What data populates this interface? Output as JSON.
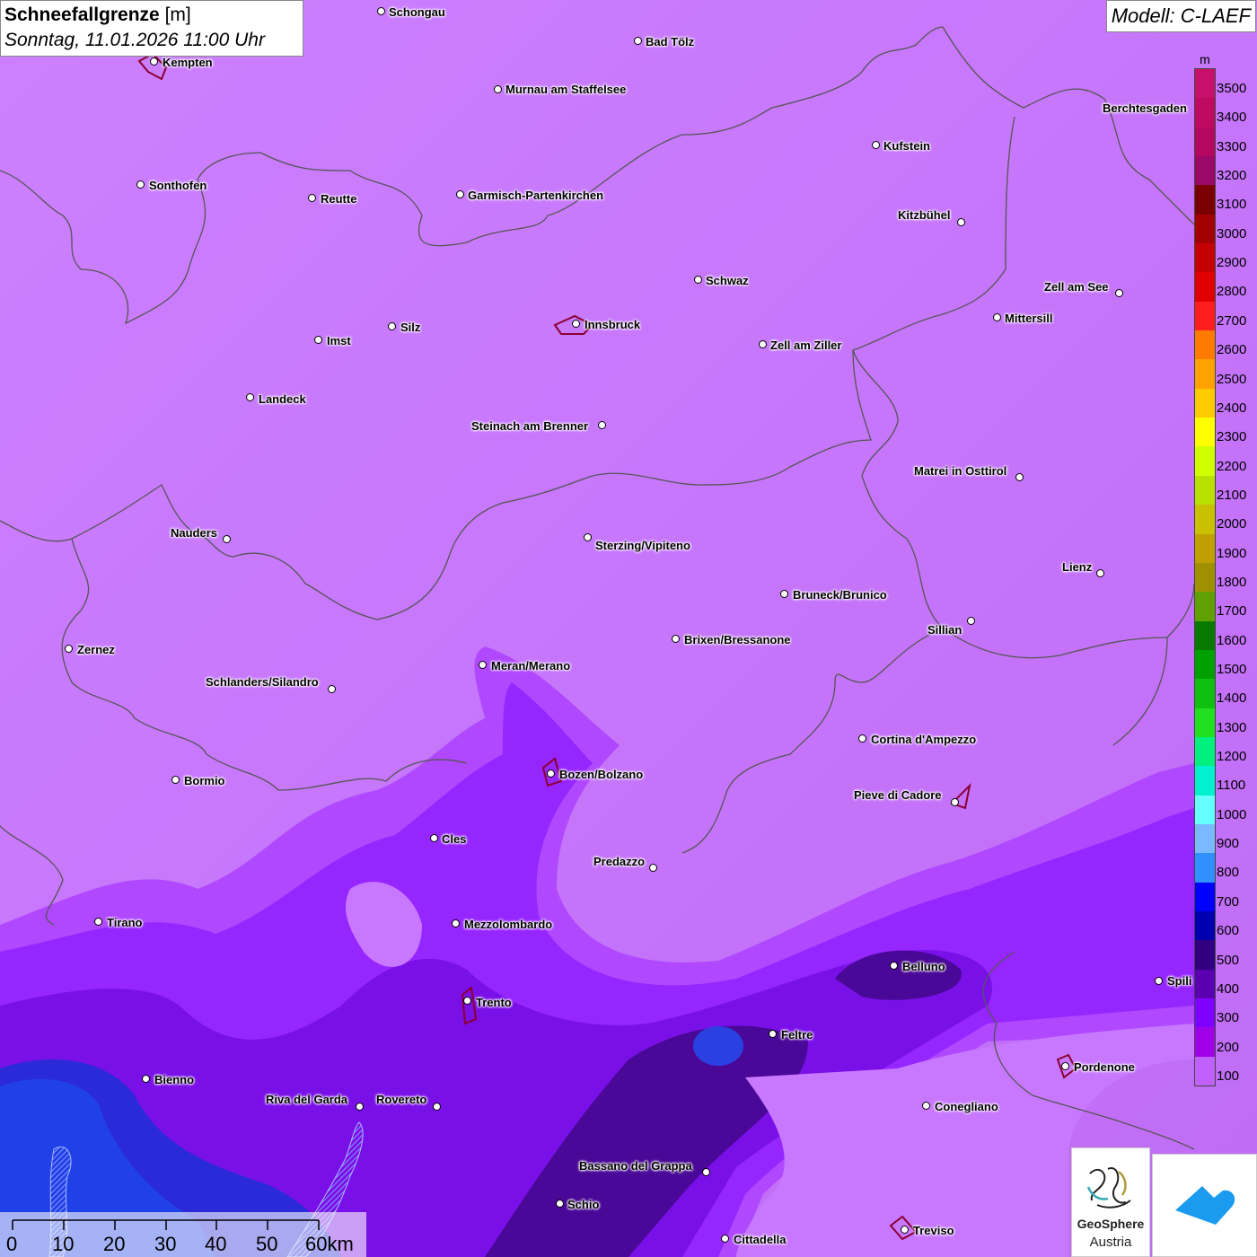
{
  "title": {
    "main": "Schneefallgrenze",
    "unit": "[m]",
    "datetime": "Sonntag, 11.01.2026 11:00 Uhr"
  },
  "model": "Modell: C-LAEF",
  "legend": {
    "unit": "m",
    "levels": [
      {
        "label": "3500",
        "color": "#c8106a"
      },
      {
        "label": "3400",
        "color": "#bf0a62"
      },
      {
        "label": "3300",
        "color": "#b40860"
      },
      {
        "label": "3200",
        "color": "#9a0868"
      },
      {
        "label": "3100",
        "color": "#7a0000"
      },
      {
        "label": "3000",
        "color": "#a30000"
      },
      {
        "label": "2900",
        "color": "#c40000"
      },
      {
        "label": "2800",
        "color": "#e00000"
      },
      {
        "label": "2700",
        "color": "#ff1e1e"
      },
      {
        "label": "2600",
        "color": "#ff7a00"
      },
      {
        "label": "2500",
        "color": "#ffa200"
      },
      {
        "label": "2400",
        "color": "#ffcb00"
      },
      {
        "label": "2300",
        "color": "#ffff00"
      },
      {
        "label": "2200",
        "color": "#d0ff00"
      },
      {
        "label": "2100",
        "color": "#b8e000"
      },
      {
        "label": "2000",
        "color": "#c8c000"
      },
      {
        "label": "1900",
        "color": "#c0a000"
      },
      {
        "label": "1800",
        "color": "#a09000"
      },
      {
        "label": "1700",
        "color": "#60a000"
      },
      {
        "label": "1600",
        "color": "#087a00"
      },
      {
        "label": "1500",
        "color": "#00a000"
      },
      {
        "label": "1400",
        "color": "#10c010"
      },
      {
        "label": "1300",
        "color": "#20e020"
      },
      {
        "label": "1200",
        "color": "#00f080"
      },
      {
        "label": "1100",
        "color": "#00f0d0"
      },
      {
        "label": "1000",
        "color": "#6ff"
      },
      {
        "label": "900",
        "color": "#7ab8ff"
      },
      {
        "label": "800",
        "color": "#3090ff"
      },
      {
        "label": "700",
        "color": "#0000ff"
      },
      {
        "label": "600",
        "color": "#0000b0"
      },
      {
        "label": "500",
        "color": "#300080"
      },
      {
        "label": "400",
        "color": "#5a00b0"
      },
      {
        "label": "300",
        "color": "#8000ff"
      },
      {
        "label": "200",
        "color": "#a000e8"
      },
      {
        "label": "100",
        "color": "#c060ff"
      }
    ]
  },
  "cities": [
    {
      "name": "Schongau"
    },
    {
      "name": "Bad Tölz"
    },
    {
      "name": "Kempten"
    },
    {
      "name": "Murnau am Staffelsee"
    },
    {
      "name": "Berchtesgaden"
    },
    {
      "name": "Kufstein"
    },
    {
      "name": "Sonthofen"
    },
    {
      "name": "Reutte"
    },
    {
      "name": "Garmisch-Partenkirchen"
    },
    {
      "name": "Kitzbühel"
    },
    {
      "name": "Schwaz"
    },
    {
      "name": "Zell am See"
    },
    {
      "name": "Mittersill"
    },
    {
      "name": "Innsbruck"
    },
    {
      "name": "Silz"
    },
    {
      "name": "Imst"
    },
    {
      "name": "Zell am Ziller"
    },
    {
      "name": "Landeck"
    },
    {
      "name": "Steinach am Brenner"
    },
    {
      "name": "Matrei in Osttirol"
    },
    {
      "name": "Nauders"
    },
    {
      "name": "Sterzing/Vipiteno"
    },
    {
      "name": "Lienz"
    },
    {
      "name": "Bruneck/Brunico"
    },
    {
      "name": "Sillian"
    },
    {
      "name": "Zernez"
    },
    {
      "name": "Brixen/Bressanone"
    },
    {
      "name": "Meran/Merano"
    },
    {
      "name": "Schlanders/Silandro"
    },
    {
      "name": "Cortina d'Ampezzo"
    },
    {
      "name": "Bormio"
    },
    {
      "name": "Bozen/Bolzano"
    },
    {
      "name": "Pieve di Cadore"
    },
    {
      "name": "Cles"
    },
    {
      "name": "Predazzo"
    },
    {
      "name": "Tirano"
    },
    {
      "name": "Mezzolombardo"
    },
    {
      "name": "Belluno"
    },
    {
      "name": "Spili"
    },
    {
      "name": "Trento"
    },
    {
      "name": "Feltre"
    },
    {
      "name": "Pordenone"
    },
    {
      "name": "Bienno"
    },
    {
      "name": "Riva del Garda"
    },
    {
      "name": "Rovereto"
    },
    {
      "name": "Conegliano"
    },
    {
      "name": "Bassano del Grappa"
    },
    {
      "name": "Schio"
    },
    {
      "name": "Treviso"
    },
    {
      "name": "Cittadella"
    }
  ],
  "scale": {
    "ticks": [
      "0",
      "10",
      "20",
      "30",
      "40",
      "50",
      "60km"
    ]
  },
  "logos": {
    "geosphere_line1": "GeoSphere",
    "geosphere_line2": "Austria"
  }
}
